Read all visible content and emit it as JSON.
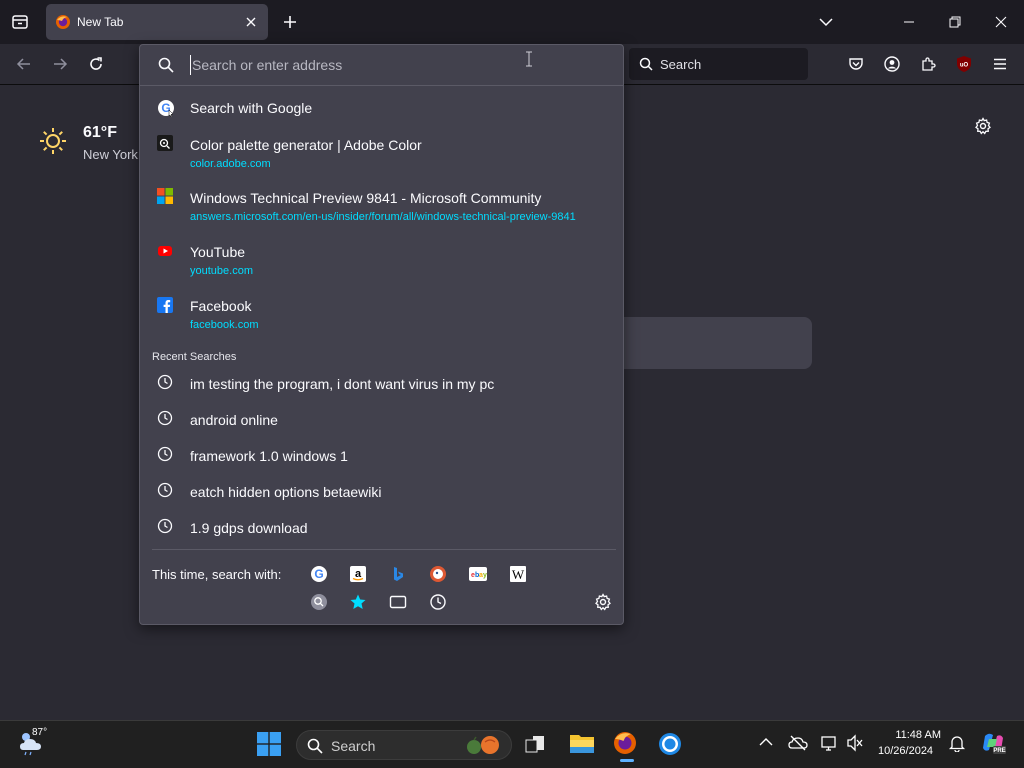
{
  "tab": {
    "title": "New Tab"
  },
  "urlbar": {
    "placeholder": "Search or enter address"
  },
  "searchbar": {
    "placeholder": "Search"
  },
  "weather": {
    "temp": "61°F",
    "city": "New York"
  },
  "suggestions": [
    {
      "title": "Search with Google",
      "url": "",
      "icon": "google-icon"
    },
    {
      "title": "Color palette generator | Adobe Color",
      "url": "color.adobe.com",
      "icon": "adobe-color-icon"
    },
    {
      "title": "Windows Technical Preview 9841 - Microsoft Community",
      "url": "answers.microsoft.com/en-us/insider/forum/all/windows-technical-preview-9841",
      "icon": "microsoft-icon"
    },
    {
      "title": "YouTube",
      "url": "youtube.com",
      "icon": "youtube-icon"
    },
    {
      "title": "Facebook",
      "url": "facebook.com",
      "icon": "facebook-icon"
    }
  ],
  "recent": {
    "heading": "Recent Searches",
    "items": [
      "im testing the program, i dont want virus in my pc",
      "android online",
      "framework 1.0 windows 1",
      "eatch hidden options betaewiki",
      "1.9 gdps download"
    ]
  },
  "footer": {
    "label": "This time, search with:",
    "engines": [
      "google",
      "amazon",
      "bing",
      "duckduckgo",
      "ebay",
      "wikipedia"
    ],
    "modes": [
      "search-icon",
      "bookmarks-icon",
      "tabs-icon",
      "history-icon"
    ]
  },
  "taskbar": {
    "weather_temp": "87°",
    "search_placeholder": "Search",
    "time": "11:48 AM",
    "date": "10/26/2024"
  },
  "colors": {
    "accent_url": "#00ddff",
    "popup_bg": "#42414d",
    "toolbar_bg": "#2b2a33"
  }
}
